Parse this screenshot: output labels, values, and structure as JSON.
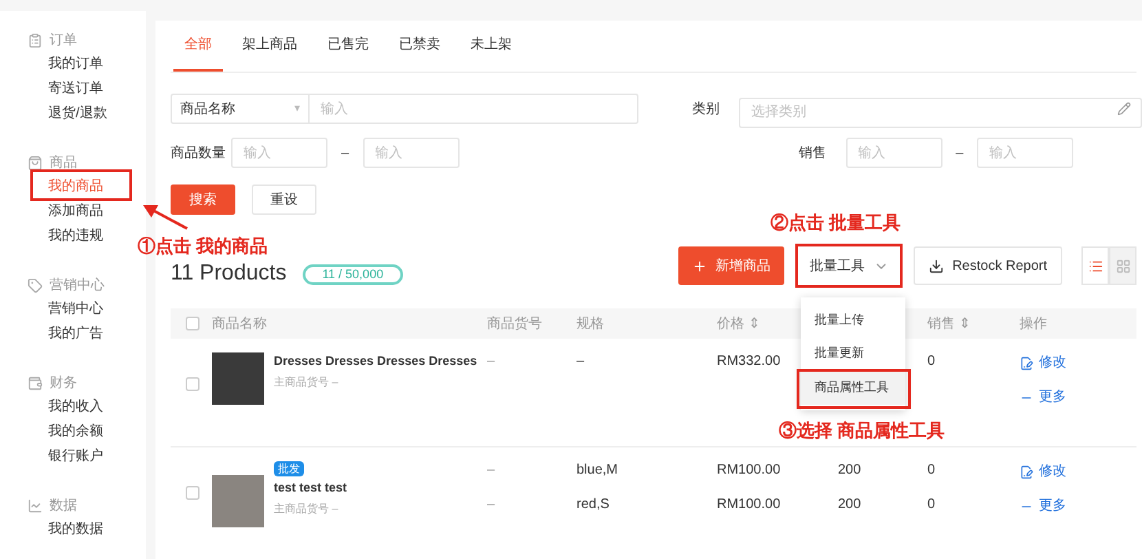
{
  "sidebar": {
    "sections": [
      {
        "title": "订单",
        "items": [
          {
            "label": "我的订单",
            "selected": false
          },
          {
            "label": "寄送订单",
            "selected": false
          },
          {
            "label": "退货/退款",
            "selected": false
          }
        ]
      },
      {
        "title": "商品",
        "items": [
          {
            "label": "我的商品",
            "selected": true
          },
          {
            "label": "添加商品",
            "selected": false
          },
          {
            "label": "我的违规",
            "selected": false
          }
        ]
      },
      {
        "title": "营销中心",
        "items": [
          {
            "label": "营销中心",
            "selected": false
          },
          {
            "label": "我的广告",
            "selected": false
          }
        ]
      },
      {
        "title": "财务",
        "items": [
          {
            "label": "我的收入",
            "selected": false
          },
          {
            "label": "我的余额",
            "selected": false
          },
          {
            "label": "银行账户",
            "selected": false
          }
        ]
      },
      {
        "title": "数据",
        "items": [
          {
            "label": "我的数据",
            "selected": false
          }
        ]
      }
    ]
  },
  "tabs": [
    {
      "label": "全部",
      "selected": true
    },
    {
      "label": "架上商品",
      "selected": false
    },
    {
      "label": "已售完",
      "selected": false
    },
    {
      "label": "已禁卖",
      "selected": false
    },
    {
      "label": "未上架",
      "selected": false
    }
  ],
  "filters": {
    "name_select": {
      "value": "商品名称",
      "caret": "▾",
      "placeholder": "输入"
    },
    "category": {
      "label": "类别",
      "placeholder": "选择类别"
    },
    "quantity": {
      "label": "商品数量",
      "from_placeholder": "输入",
      "separator": "–",
      "to_placeholder": "输入"
    },
    "sales": {
      "label": "销售",
      "from_placeholder": "输入",
      "separator": "–",
      "to_placeholder": "输入"
    },
    "buttons": [
      {
        "label": "搜索",
        "kind": "primary"
      },
      {
        "label": "重设",
        "kind": "secondary"
      }
    ]
  },
  "summary": {
    "title": "11 Products",
    "quota": "11 / 50,000"
  },
  "toolbar": {
    "add_button": "新增商品",
    "batch_button": "批量工具",
    "report_button": "Restock Report",
    "view_toggle": [
      {
        "selected": true
      },
      {
        "selected": false
      }
    ]
  },
  "batch_menu": {
    "items": [
      {
        "label": "批量上传",
        "highlighted": false
      },
      {
        "label": "批量更新",
        "highlighted": false
      },
      {
        "label": "商品属性工具",
        "highlighted": true
      }
    ]
  },
  "table": {
    "select_all_checked": false,
    "columns": [
      {
        "label": "商品名称"
      },
      {
        "label": "商品货号"
      },
      {
        "label": "规格"
      },
      {
        "label": "价格",
        "sort_mark": "⇕"
      },
      {
        "label": "销售",
        "sort_mark": "⇕"
      },
      {
        "label": "操作"
      }
    ],
    "rows": [
      {
        "checked": false,
        "name": "Dresses Dresses Dresses Dresses",
        "sku_label": "主商品货号 –",
        "variants": [
          {
            "sku": "–",
            "spec": "–",
            "price": "RM332.00",
            "sales": "0"
          }
        ],
        "actions": [
          "修改",
          "更多"
        ]
      },
      {
        "checked": false,
        "tag": "批发",
        "name": "test test test",
        "sku_label": "主商品货号 –",
        "variants": [
          {
            "sku": "–",
            "spec": "blue,M",
            "price": "RM100.00",
            "stock": "200",
            "sales": "0"
          },
          {
            "sku": "–",
            "spec": "red,S",
            "price": "RM100.00",
            "stock": "200",
            "sales": "0"
          }
        ],
        "actions": [
          "修改",
          "更多"
        ]
      }
    ]
  },
  "annotations": [
    {
      "kind": "step",
      "text": "①点击 我的商品"
    },
    {
      "kind": "step",
      "text": "②点击 批量工具"
    },
    {
      "kind": "step",
      "text": "③选择 商品属性工具"
    }
  ]
}
